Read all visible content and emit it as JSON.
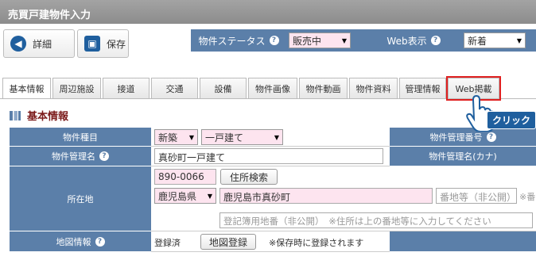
{
  "title": "売買戸建物件入力",
  "toolbar": {
    "detail_label": "詳細",
    "save_label": "保存"
  },
  "status": {
    "property_status_label": "物件ステータス",
    "property_status_value": "販売中",
    "web_display_label": "Web表示",
    "web_display_value": "新着"
  },
  "tabs": [
    "基本情報",
    "周辺施設",
    "接道",
    "交通",
    "設備",
    "物件画像",
    "物件動画",
    "物件資料",
    "管理情報",
    "Web掲載"
  ],
  "section": {
    "title": "基本情報"
  },
  "form": {
    "type_label": "物件種目",
    "type_value1": "新築",
    "type_value2": "一戸建て",
    "mgmt_no_label": "物件管理番号",
    "mgmt_name_label": "物件管理名",
    "mgmt_name_value": "真砂町一戸建て",
    "mgmt_name_kana_label": "物件管理名(カナ)",
    "location_label": "所在地",
    "postal_value": "890-0066",
    "address_search_label": "住所検索",
    "prefecture_value": "鹿児島県",
    "city_value": "鹿児島市真砂町",
    "lot_placeholder": "番地等（非公開）",
    "lot_note": "※番",
    "registry_placeholder": "登記簿用地番（非公開）　※住所は上の番地等に入力してください",
    "map_label": "地図情報",
    "map_status": "登録済",
    "map_register_label": "地図登録",
    "map_note": "※保存時に登録されます"
  },
  "annotation": {
    "click_label": "クリック"
  },
  "colors": {
    "header_blue": "#5b7fa9",
    "accent_red": "#e02020",
    "pink_field": "#fde4ef"
  }
}
